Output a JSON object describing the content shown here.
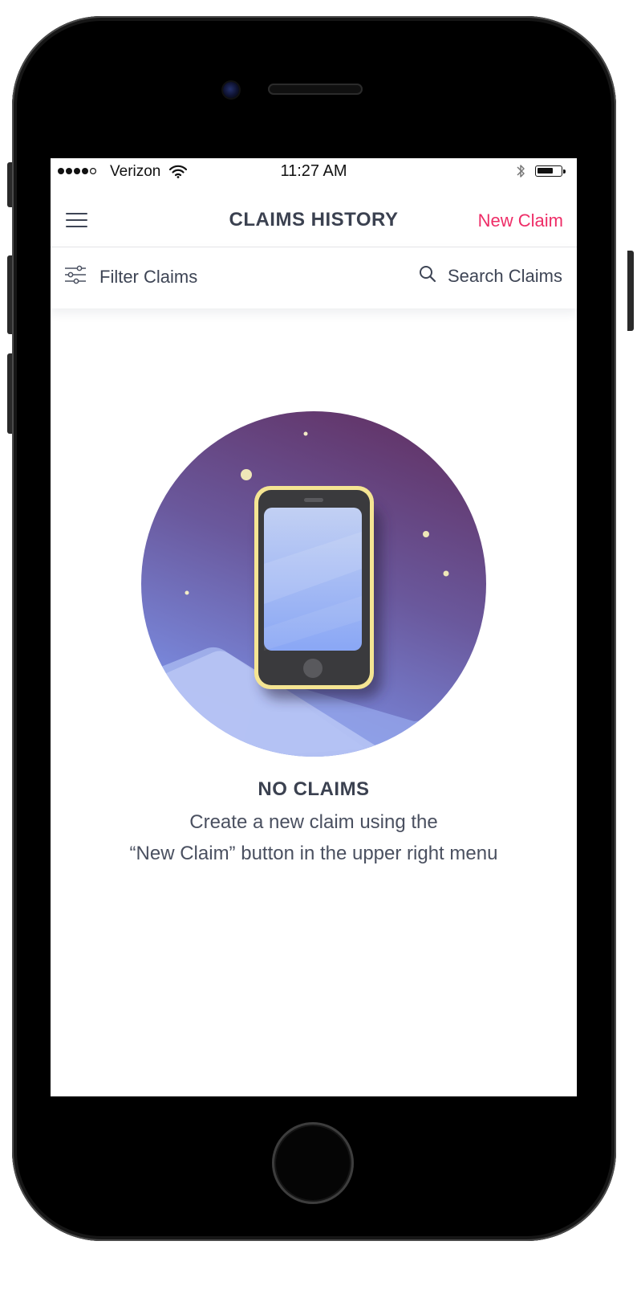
{
  "status_bar": {
    "signal_filled": 4,
    "signal_total": 5,
    "carrier": "Verizon",
    "time": "11:27 AM",
    "battery_level": 0.7
  },
  "nav": {
    "menu_icon": "hamburger-menu-icon",
    "title": "CLAIMS HISTORY",
    "new_claim_label": "New Claim"
  },
  "filter_bar": {
    "filter_icon": "sliders-icon",
    "filter_label": "Filter Claims",
    "search_icon": "search-icon",
    "search_label": "Search Claims"
  },
  "empty_state": {
    "illustration": "phone-illustration",
    "title": "NO CLAIMS",
    "line1": "Create a new claim using the",
    "line2": "“New Claim” button in the upper right menu"
  },
  "colors": {
    "accent": "#ee2d67",
    "text_dark": "#3b4150",
    "illustration_top": "#64366e",
    "illustration_bottom": "#7f95ee"
  }
}
